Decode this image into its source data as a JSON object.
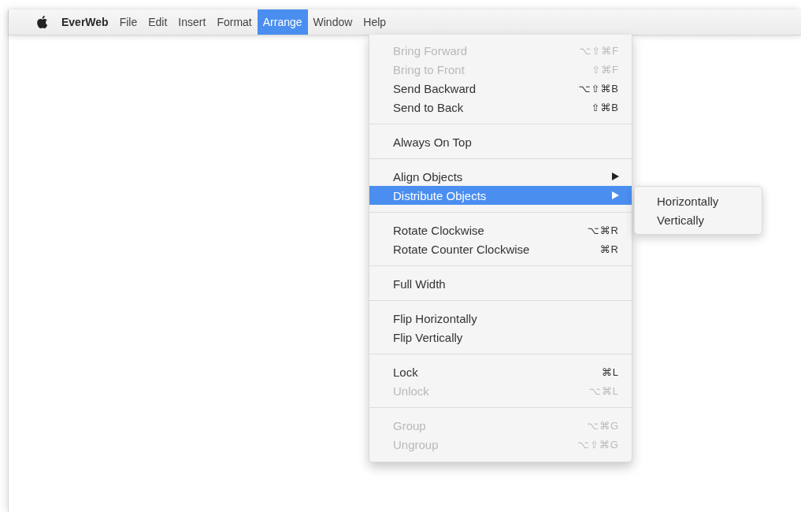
{
  "menu_bar": {
    "app_name": "EverWeb",
    "menus": [
      {
        "label": "File",
        "selected": false
      },
      {
        "label": "Edit",
        "selected": false
      },
      {
        "label": "Insert",
        "selected": false
      },
      {
        "label": "Format",
        "selected": false
      },
      {
        "label": "Arrange",
        "selected": true
      },
      {
        "label": "Window",
        "selected": false
      },
      {
        "label": "Help",
        "selected": false
      }
    ]
  },
  "arrange_menu": {
    "groups": [
      [
        {
          "label": "Bring Forward",
          "shortcut": "⌥⇧⌘F",
          "disabled": true,
          "selected": false,
          "has_submenu": false
        },
        {
          "label": "Bring to Front",
          "shortcut": "⇧⌘F",
          "disabled": true,
          "selected": false,
          "has_submenu": false
        },
        {
          "label": "Send Backward",
          "shortcut": "⌥⇧⌘B",
          "disabled": false,
          "selected": false,
          "has_submenu": false
        },
        {
          "label": "Send to Back",
          "shortcut": "⇧⌘B",
          "disabled": false,
          "selected": false,
          "has_submenu": false
        }
      ],
      [
        {
          "label": "Always On Top",
          "disabled": false,
          "selected": false,
          "has_submenu": false
        }
      ],
      [
        {
          "label": "Align Objects",
          "disabled": false,
          "selected": false,
          "has_submenu": true
        },
        {
          "label": "Distribute Objects",
          "disabled": false,
          "selected": true,
          "has_submenu": true
        }
      ],
      [
        {
          "label": "Rotate Clockwise",
          "shortcut": "⌥⌘R",
          "disabled": false,
          "selected": false,
          "has_submenu": false
        },
        {
          "label": "Rotate Counter Clockwise",
          "shortcut": "⌘R",
          "disabled": false,
          "selected": false,
          "has_submenu": false
        }
      ],
      [
        {
          "label": "Full Width",
          "disabled": false,
          "selected": false,
          "has_submenu": false
        }
      ],
      [
        {
          "label": "Flip Horizontally",
          "disabled": false,
          "selected": false,
          "has_submenu": false
        },
        {
          "label": "Flip Vertically",
          "disabled": false,
          "selected": false,
          "has_submenu": false
        }
      ],
      [
        {
          "label": "Lock",
          "shortcut": "⌘L",
          "disabled": false,
          "selected": false,
          "has_submenu": false
        },
        {
          "label": "Unlock",
          "shortcut": "⌥⌘L",
          "disabled": true,
          "selected": false,
          "has_submenu": false
        }
      ],
      [
        {
          "label": "Group",
          "shortcut": "⌥⌘G",
          "disabled": true,
          "selected": false,
          "has_submenu": false
        },
        {
          "label": "Ungroup",
          "shortcut": "⌥⇧⌘G",
          "disabled": true,
          "selected": false,
          "has_submenu": false
        }
      ]
    ]
  },
  "distribute_submenu": {
    "items": [
      {
        "label": "Horizontally",
        "selected": false
      },
      {
        "label": "Vertically",
        "selected": false
      }
    ]
  }
}
